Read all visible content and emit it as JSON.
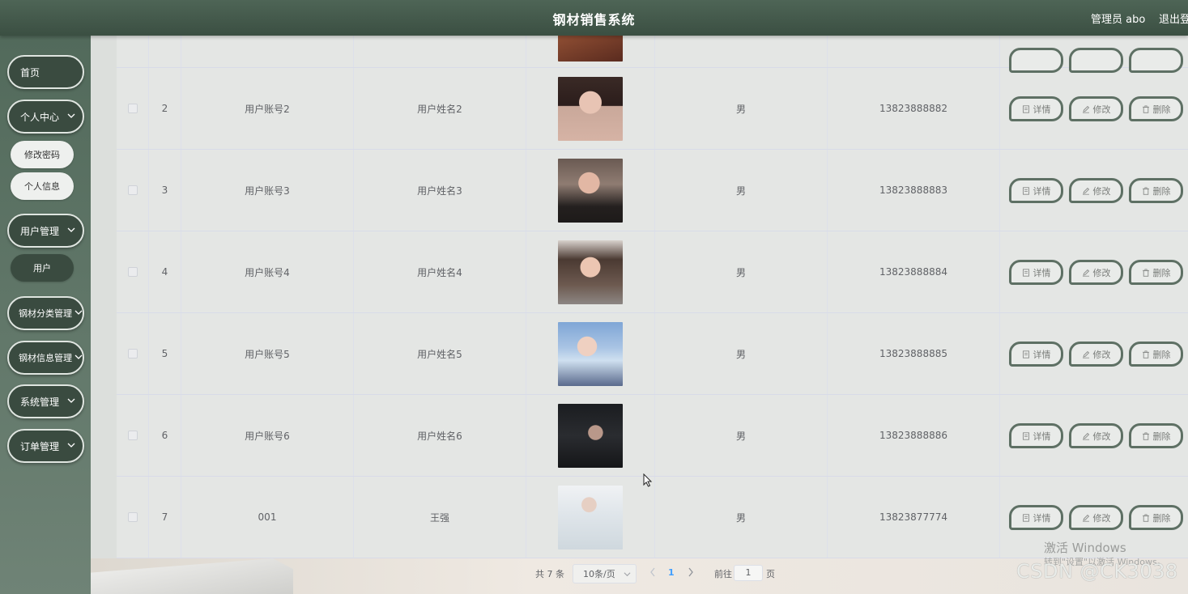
{
  "header": {
    "title": "钢材销售系统",
    "admin_label": "管理员 abo",
    "logout_label": "退出登"
  },
  "sidebar": {
    "items": [
      {
        "label": "首页",
        "has_chevron": false
      },
      {
        "label": "个人中心",
        "has_chevron": true
      },
      {
        "label": "用户管理",
        "has_chevron": true
      },
      {
        "label": "钢材分类管理",
        "has_chevron": true
      },
      {
        "label": "钢材信息管理",
        "has_chevron": true
      },
      {
        "label": "系统管理",
        "has_chevron": true
      },
      {
        "label": "订单管理",
        "has_chevron": true
      }
    ],
    "personal_sub": [
      "修改密码",
      "个人信息"
    ],
    "user_sub": [
      "用户"
    ]
  },
  "table": {
    "rows": [
      {
        "index": "2",
        "account": "用户账号2",
        "name": "用户姓名2",
        "photo": "woman-portrait-1",
        "sex": "男",
        "phone": "13823888882"
      },
      {
        "index": "3",
        "account": "用户账号3",
        "name": "用户姓名3",
        "photo": "man-portrait-1",
        "sex": "男",
        "phone": "13823888883"
      },
      {
        "index": "4",
        "account": "用户账号4",
        "name": "用户姓名4",
        "photo": "woman-portrait-2",
        "sex": "男",
        "phone": "13823888884"
      },
      {
        "index": "5",
        "account": "用户账号5",
        "name": "用户姓名5",
        "photo": "woman-portrait-3",
        "sex": "男",
        "phone": "13823888885"
      },
      {
        "index": "6",
        "account": "用户账号6",
        "name": "用户姓名6",
        "photo": "man-portrait-2",
        "sex": "男",
        "phone": "13823888886"
      },
      {
        "index": "7",
        "account": "001",
        "name": "王强",
        "photo": "man-portrait-3",
        "sex": "男",
        "phone": "13823877774"
      }
    ],
    "actions": {
      "detail": "详情",
      "edit": "修改",
      "delete": "删除"
    }
  },
  "pagination": {
    "total": "共 7 条",
    "page_size": "10条/页",
    "current_page": "1",
    "goto_label": "前往",
    "goto_value": "1",
    "page_word": "页"
  },
  "watermark": {
    "activate_title": "激活 Windows",
    "activate_sub": "转到\"设置\"以激活 Windows。",
    "csdn": "CSDN @CK3038"
  },
  "colors": {
    "header": "#4e6556",
    "sidebar_button": "#3a4b40",
    "action_border": "#5e7064",
    "active_page": "#409eff"
  }
}
